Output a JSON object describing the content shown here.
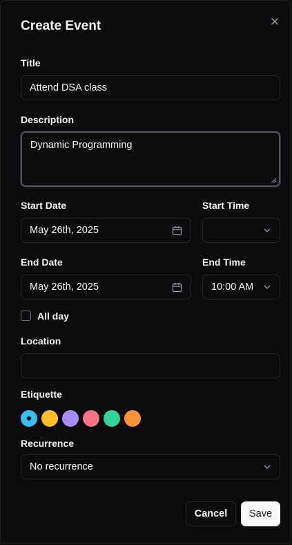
{
  "dialog": {
    "title": "Create Event",
    "close_icon": "close-icon"
  },
  "form": {
    "title_label": "Title",
    "title_value": "Attend DSA class",
    "description_label": "Description",
    "description_value": "Dynamic Programming",
    "start_date_label": "Start Date",
    "start_date_value": "May 26th, 2025",
    "start_time_label": "Start Time",
    "start_time_value": "",
    "end_date_label": "End Date",
    "end_date_value": "May 26th, 2025",
    "end_time_label": "End Time",
    "end_time_value": "10:00 AM",
    "all_day_label": "All day",
    "all_day_checked": false,
    "location_label": "Location",
    "location_value": "",
    "etiquette_label": "Etiquette",
    "etiquette_colors": [
      "#38bdf8",
      "#fbbf24",
      "#a78bfa",
      "#fb7185",
      "#34d399",
      "#fb923c"
    ],
    "etiquette_selected": "#38bdf8",
    "recurrence_label": "Recurrence",
    "recurrence_value": "No recurrence"
  },
  "actions": {
    "cancel_label": "Cancel",
    "save_label": "Save"
  }
}
